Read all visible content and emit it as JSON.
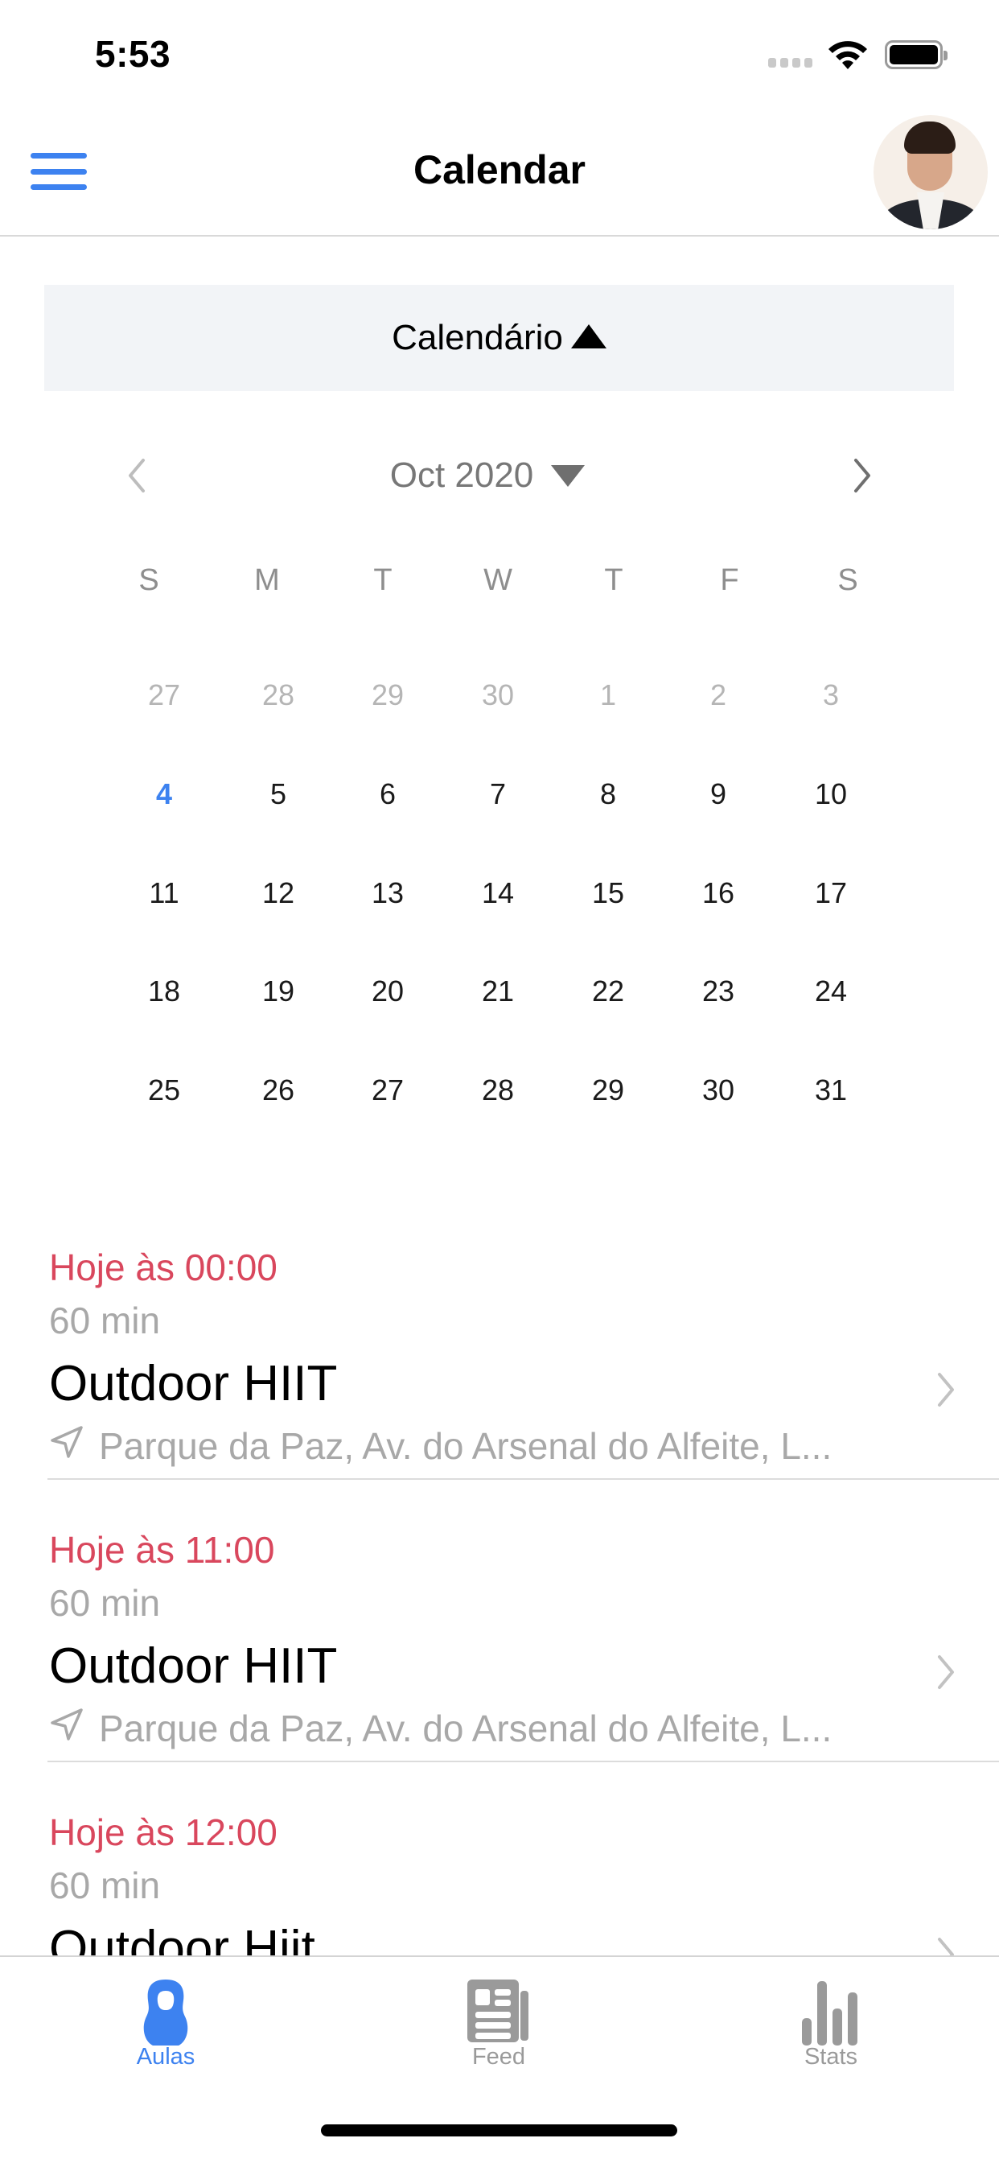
{
  "status_bar": {
    "time": "5:53",
    "icons": [
      "signal-icon",
      "wifi-icon",
      "battery-icon"
    ]
  },
  "header": {
    "title": "Calendar",
    "menu_icon": "hamburger-menu-icon",
    "avatar": "user-avatar"
  },
  "calendar_toggle": {
    "label": "Calendário",
    "icon": "triangle-up-icon"
  },
  "month_nav": {
    "label": "Oct 2020",
    "prev_icon": "chevron-left-icon",
    "next_icon": "chevron-right-icon",
    "dropdown_icon": "triangle-down-icon"
  },
  "calendar": {
    "weekdays": [
      "S",
      "M",
      "T",
      "W",
      "T",
      "F",
      "S"
    ],
    "today": "4",
    "weeks": [
      [
        {
          "d": "27",
          "muted": true
        },
        {
          "d": "28",
          "muted": true
        },
        {
          "d": "29",
          "muted": true
        },
        {
          "d": "30",
          "muted": true
        },
        {
          "d": "1",
          "muted": true
        },
        {
          "d": "2",
          "muted": true
        },
        {
          "d": "3",
          "muted": true
        }
      ],
      [
        {
          "d": "4",
          "today": true
        },
        {
          "d": "5"
        },
        {
          "d": "6"
        },
        {
          "d": "7"
        },
        {
          "d": "8"
        },
        {
          "d": "9"
        },
        {
          "d": "10"
        }
      ],
      [
        {
          "d": "11"
        },
        {
          "d": "12"
        },
        {
          "d": "13"
        },
        {
          "d": "14"
        },
        {
          "d": "15"
        },
        {
          "d": "16"
        },
        {
          "d": "17"
        }
      ],
      [
        {
          "d": "18"
        },
        {
          "d": "19"
        },
        {
          "d": "20"
        },
        {
          "d": "21"
        },
        {
          "d": "22"
        },
        {
          "d": "23"
        },
        {
          "d": "24"
        }
      ],
      [
        {
          "d": "25"
        },
        {
          "d": "26"
        },
        {
          "d": "27"
        },
        {
          "d": "28"
        },
        {
          "d": "29"
        },
        {
          "d": "30"
        },
        {
          "d": "31"
        }
      ]
    ]
  },
  "events": [
    {
      "time": "Hoje às 00:00",
      "duration": "60 min",
      "title": "Outdoor HIIT",
      "location": "Parque da Paz, Av. do Arsenal do Alfeite, L..."
    },
    {
      "time": "Hoje às 11:00",
      "duration": "60 min",
      "title": "Outdoor HIIT",
      "location": "Parque da Paz, Av. do Arsenal do Alfeite, L..."
    },
    {
      "time": "Hoje às 12:00",
      "duration": "60 min",
      "title": "Outdoor Hiit",
      "location": ""
    }
  ],
  "tabbar": {
    "tabs": [
      {
        "label": "Aulas",
        "icon": "kettlebell-icon",
        "active": true
      },
      {
        "label": "Feed",
        "icon": "newspaper-icon",
        "active": false
      },
      {
        "label": "Stats",
        "icon": "bar-chart-icon",
        "active": false
      }
    ]
  },
  "colors": {
    "accent": "#3d82f0",
    "event_time": "#d9475d",
    "secondary_text": "#a8a8a8",
    "toggle_bg": "#f2f4f7",
    "inactive_tab": "#9a9a9a"
  }
}
